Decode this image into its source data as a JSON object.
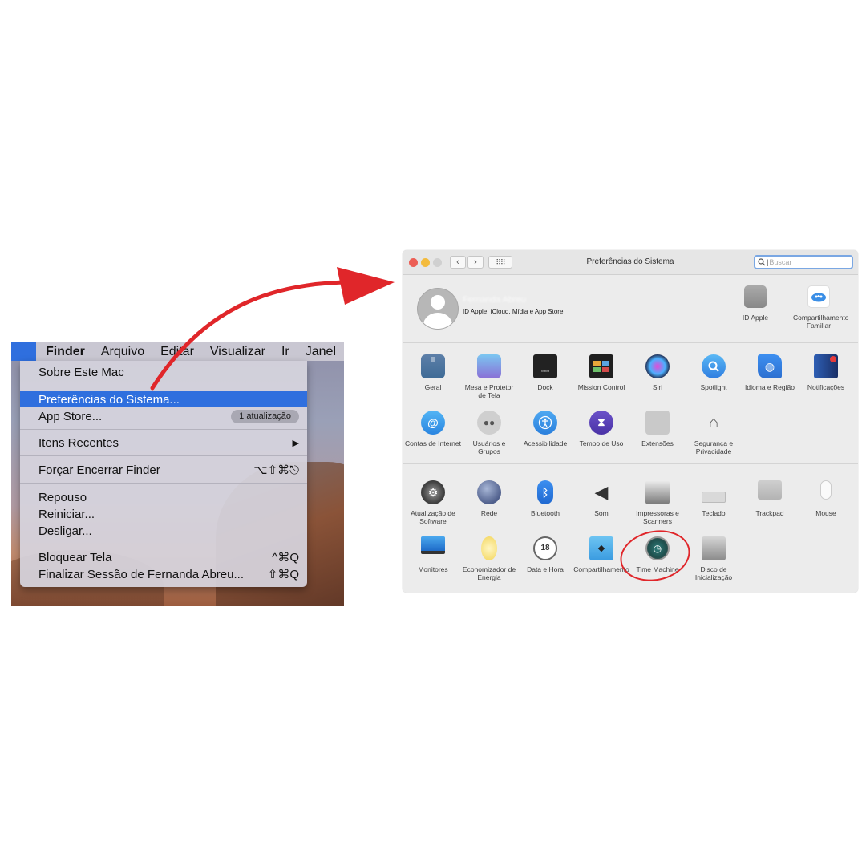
{
  "menu_screenshot": {
    "menubar": {
      "apple_icon": "apple-logo-icon",
      "app_name": "Finder",
      "items": [
        "Arquivo",
        "Editar",
        "Visualizar",
        "Ir",
        "Janel"
      ]
    },
    "menu_items": {
      "about": "Sobre Este Mac",
      "system_prefs": "Preferências do Sistema...",
      "app_store": "App Store...",
      "app_store_badge": "1 atualização",
      "recent_items": "Itens Recentes",
      "recent_arrow": "▶",
      "force_quit": "Forçar Encerrar Finder",
      "force_quit_shortcut": "⌥⇧⌘⎋",
      "sleep": "Repouso",
      "restart": "Reiniciar...",
      "shutdown": "Desligar...",
      "lock": "Bloquear Tela",
      "lock_shortcut": "^⌘Q",
      "logout": "Finalizar Sessão de Fernanda Abreu...",
      "logout_shortcut": "⇧⌘Q"
    },
    "highlight_color": "#2f6fde"
  },
  "arrow_color": "#e0262a",
  "prefs_window": {
    "title": "Preferências do Sistema",
    "search_placeholder": "Buscar",
    "nav": {
      "back": "‹",
      "forward": "›",
      "grid": "⠿⠿"
    },
    "account": {
      "name": "Fernanda Abreu",
      "subtitle": "ID Apple, iCloud, Mídia e App Store",
      "icons": [
        {
          "label": "ID Apple",
          "icon": "apple-id-icon"
        },
        {
          "label": "Compartilhamento Familiar",
          "icon": "family-sharing-icon"
        }
      ]
    },
    "section1": [
      {
        "label": "Geral",
        "icon": "general-icon"
      },
      {
        "label": "Mesa e Protetor de Tela",
        "icon": "desktop-screensaver-icon"
      },
      {
        "label": "Dock",
        "icon": "dock-icon"
      },
      {
        "label": "Mission Control",
        "icon": "mission-control-icon"
      },
      {
        "label": "Siri",
        "icon": "siri-icon"
      },
      {
        "label": "Spotlight",
        "icon": "spotlight-icon"
      },
      {
        "label": "Idioma e Região",
        "icon": "language-region-icon"
      },
      {
        "label": "Notificações",
        "icon": "notifications-icon"
      },
      {
        "label": "Contas de Internet",
        "icon": "internet-accounts-icon"
      },
      {
        "label": "Usuários e Grupos",
        "icon": "users-groups-icon"
      },
      {
        "label": "Acessibilidade",
        "icon": "accessibility-icon"
      },
      {
        "label": "Tempo de Uso",
        "icon": "screen-time-icon"
      },
      {
        "label": "Extensões",
        "icon": "extensions-icon"
      },
      {
        "label": "Segurança e Privacidade",
        "icon": "security-privacy-icon"
      }
    ],
    "section2": [
      {
        "label": "Atualização de Software",
        "icon": "software-update-icon"
      },
      {
        "label": "Rede",
        "icon": "network-icon"
      },
      {
        "label": "Bluetooth",
        "icon": "bluetooth-icon"
      },
      {
        "label": "Som",
        "icon": "sound-icon"
      },
      {
        "label": "Impressoras e Scanners",
        "icon": "printers-scanners-icon"
      },
      {
        "label": "Teclado",
        "icon": "keyboard-icon"
      },
      {
        "label": "Trackpad",
        "icon": "trackpad-icon"
      },
      {
        "label": "Mouse",
        "icon": "mouse-icon"
      },
      {
        "label": "Monitores",
        "icon": "displays-icon"
      },
      {
        "label": "Economizador de Energia",
        "icon": "energy-saver-icon"
      },
      {
        "label": "Data e Hora",
        "icon": "date-time-icon"
      },
      {
        "label": "Compartilhamento",
        "icon": "sharing-icon"
      },
      {
        "label": "Time Machine",
        "icon": "time-machine-icon"
      },
      {
        "label": "Disco de Inicialização",
        "icon": "startup-disk-icon"
      }
    ]
  }
}
